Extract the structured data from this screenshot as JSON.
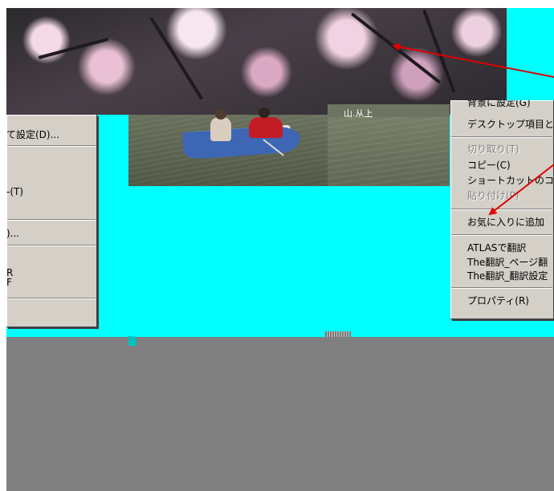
{
  "colors": {
    "desktop_background": "#00ffff",
    "lower_area": "#808080",
    "menu_face": "#d4d0c8",
    "annotation_arrow": "#e00000",
    "boat": "#3d67b4",
    "rower_jacket": "#c21d24"
  },
  "photo": {
    "partial_caption": "山.从上"
  },
  "left_menu": {
    "items": [
      {
        "label": "て設定(D)...",
        "disabled": false
      },
      {
        "label": "-(T)",
        "disabled": false
      },
      {
        "label": ")...",
        "disabled": false
      },
      {
        "label": "R",
        "disabled": false
      },
      {
        "label": "F",
        "disabled": false
      }
    ]
  },
  "right_menu": {
    "items": [
      {
        "label": "背景に設定(G)",
        "disabled": false
      },
      {
        "label": "デスクトップ項目とし",
        "disabled": false
      },
      {
        "label": "切り取り(T)",
        "disabled": true
      },
      {
        "label": "コピー(C)",
        "disabled": false
      },
      {
        "label": "ショートカットのコピ",
        "disabled": false
      },
      {
        "label": "貼り付け(P)",
        "disabled": true
      },
      {
        "label": "お気に入りに追加",
        "disabled": false
      },
      {
        "label": "ATLASで翻訳",
        "disabled": false
      },
      {
        "label": "The翻訳_ページ翻",
        "disabled": false
      },
      {
        "label": "The翻訳_翻訳設定",
        "disabled": false
      },
      {
        "label": "プロパティ(R)",
        "disabled": false
      }
    ]
  },
  "icons": {
    "arrow_a": "annotation-arrow-icon",
    "arrow_b": "annotation-arrow-icon"
  }
}
